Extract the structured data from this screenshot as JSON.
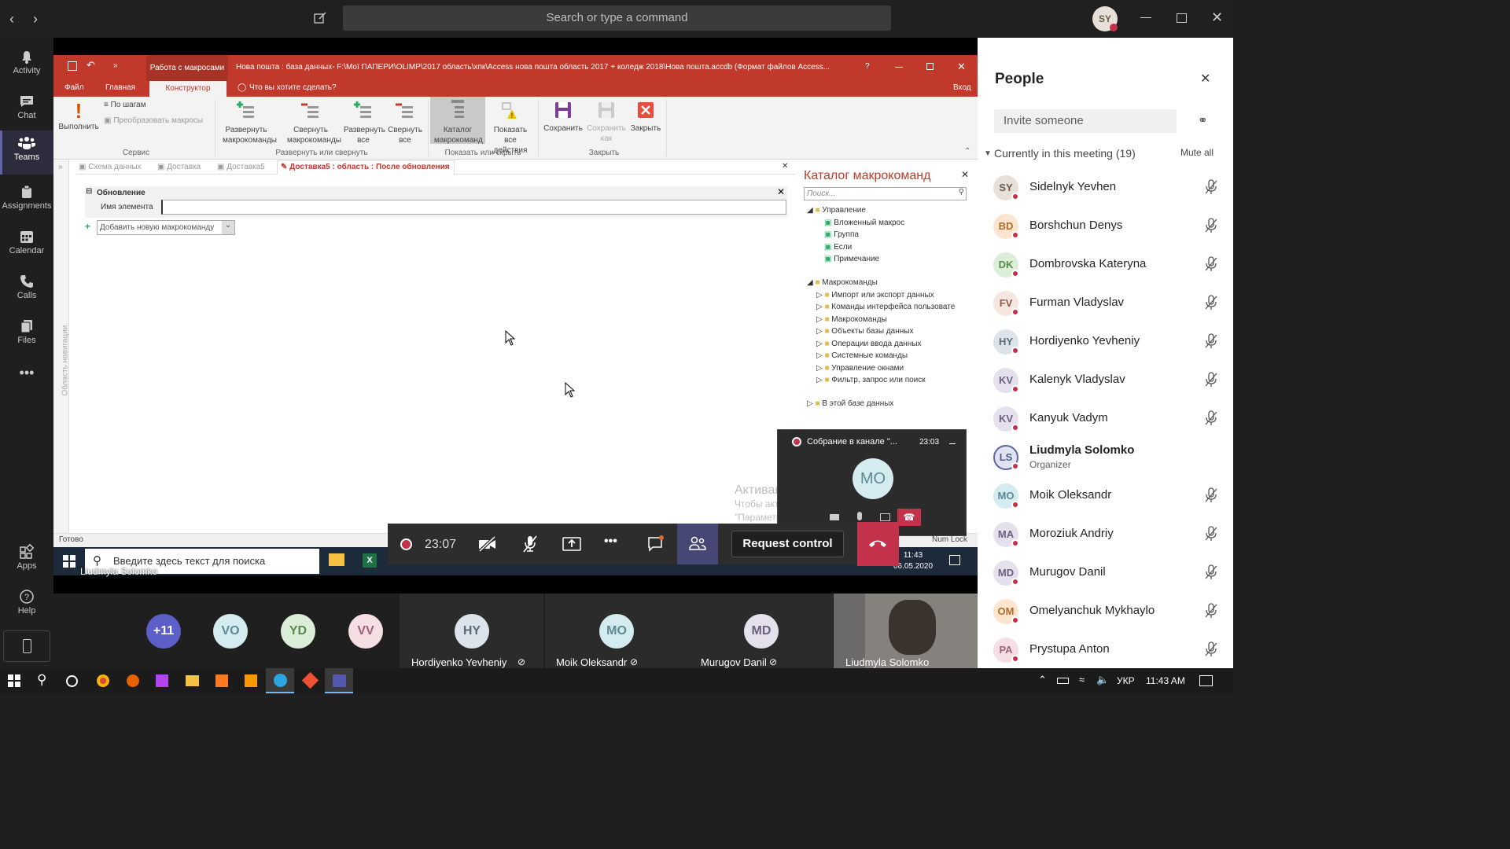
{
  "teams": {
    "search_placeholder": "Search or type a command",
    "user_initials": "SY",
    "rail": [
      {
        "label": "Activity",
        "icon": "bell-icon"
      },
      {
        "label": "Chat",
        "icon": "chat-icon"
      },
      {
        "label": "Teams",
        "icon": "teams-icon"
      },
      {
        "label": "Assignments",
        "icon": "assignments-icon"
      },
      {
        "label": "Calendar",
        "icon": "calendar-icon"
      },
      {
        "label": "Calls",
        "icon": "phone-icon"
      },
      {
        "label": "Files",
        "icon": "files-icon"
      },
      {
        "label": "Apps",
        "icon": "apps-icon"
      },
      {
        "label": "Help",
        "icon": "help-icon"
      }
    ]
  },
  "access": {
    "context_tab": "Работа с макросами",
    "title": "Нова пошта : база данных- F:\\Мої ПАПЕРИ\\OLIMP\\2017 область\\хпк\\Access нова пошта область 2017 + коледж 2018\\Нова пошта.accdb (Формат файлов Access...",
    "tabs": [
      "Файл",
      "Главная",
      "Конструктор"
    ],
    "tell_me": "Что вы хотите сделать?",
    "login": "Вход",
    "ribbon": {
      "run": "Выполнить",
      "step": "По шагам",
      "convert": "Преобразовать макросы",
      "group_service": "Сервис",
      "expand_actions": "Развернуть макрокоманды",
      "collapse_actions": "Свернуть макрокоманды",
      "expand_all": "Развернуть все",
      "collapse_all": "Свернуть все",
      "group_expand": "Развернуть или свернуть",
      "catalog": "Каталог макрокоманд",
      "show_all": "Показать все действия",
      "group_show": "Показать или скрыть",
      "save": "Сохранить",
      "save_as": "Сохранить как",
      "close": "Закрыть",
      "group_close": "Закрыть"
    },
    "doc_tabs": [
      "Схема данных",
      "Доставка",
      "Доставка5",
      "Доставка5 : область : После обновления"
    ],
    "nav_pane": "Область навигации",
    "macro": {
      "block_title": "Обновление",
      "field_label": "Имя элемента",
      "field_value": "",
      "add_action": "Добавить новую макрокоманду"
    },
    "catalog": {
      "title": "Каталог макрокоманд",
      "search_placeholder": "Поиск...",
      "control_folder": "Управление",
      "control_items": [
        "Вложенный макрос",
        "Группа",
        "Если",
        "Примечание"
      ],
      "actions_folder": "Макрокоманды",
      "action_items": [
        "Импорт или экспорт данных",
        "Команды интерфейса пользовате",
        "Макрокоманды",
        "Объекты базы данных",
        "Операции ввода данных",
        "Системные команды",
        "Управление окнами",
        "Фильтр, запрос или поиск"
      ],
      "in_db": "В этой базе данных"
    },
    "status": "Готово",
    "numlock": "Num Lock",
    "win_search": "Введите здесь текст для поиска",
    "win_time": "11:43",
    "win_date": "06.05.2020",
    "activation_title": "Активация Windows",
    "activation_text": "Чтобы активировать Windows, перейдите в раздел \"Параметры\"."
  },
  "mini_meeting": {
    "title": "Собрание в канале \"...",
    "time": "23:03",
    "initials": "MO"
  },
  "call_controls": {
    "timer": "23:07",
    "request_control": "Request control"
  },
  "presenter_label": "Liudmyla Solomko",
  "tiles": {
    "overflow": "+11",
    "small": [
      "VO",
      "YD",
      "VV"
    ],
    "named": [
      {
        "initials": "HY",
        "name": "Hordiyenko Yevheniy"
      },
      {
        "initials": "MO",
        "name": "Moik Oleksandr"
      },
      {
        "initials": "MD",
        "name": "Murugov Danil"
      }
    ],
    "video_name": "Liudmyla Solomko"
  },
  "people": {
    "title": "People",
    "invite_placeholder": "Invite someone",
    "section": "Currently in this meeting (19)",
    "mute_all": "Mute all",
    "organizer_label": "Organizer",
    "list": [
      {
        "initials": "SY",
        "name": "Sidelnyk Yevhen"
      },
      {
        "initials": "BD",
        "name": "Borshchun Denys"
      },
      {
        "initials": "DK",
        "name": "Dombrovska Kateryna"
      },
      {
        "initials": "FV",
        "name": "Furman Vladyslav"
      },
      {
        "initials": "HY",
        "name": "Hordiyenko Yevheniy"
      },
      {
        "initials": "KV",
        "name": "Kalenyk Vladyslav"
      },
      {
        "initials": "KV",
        "name": "Kanyuk Vadym"
      },
      {
        "initials": "LS",
        "name": "Liudmyla Solomko"
      },
      {
        "initials": "MO",
        "name": "Moik Oleksandr"
      },
      {
        "initials": "MA",
        "name": "Moroziuk Andriy"
      },
      {
        "initials": "MD",
        "name": "Murugov Danil"
      },
      {
        "initials": "OM",
        "name": "Omelyanchuk Mykhaylo"
      },
      {
        "initials": "PA",
        "name": "Prystupa Anton"
      }
    ]
  },
  "taskbar": {
    "lang": "УКР",
    "time": "11:43 AM"
  }
}
